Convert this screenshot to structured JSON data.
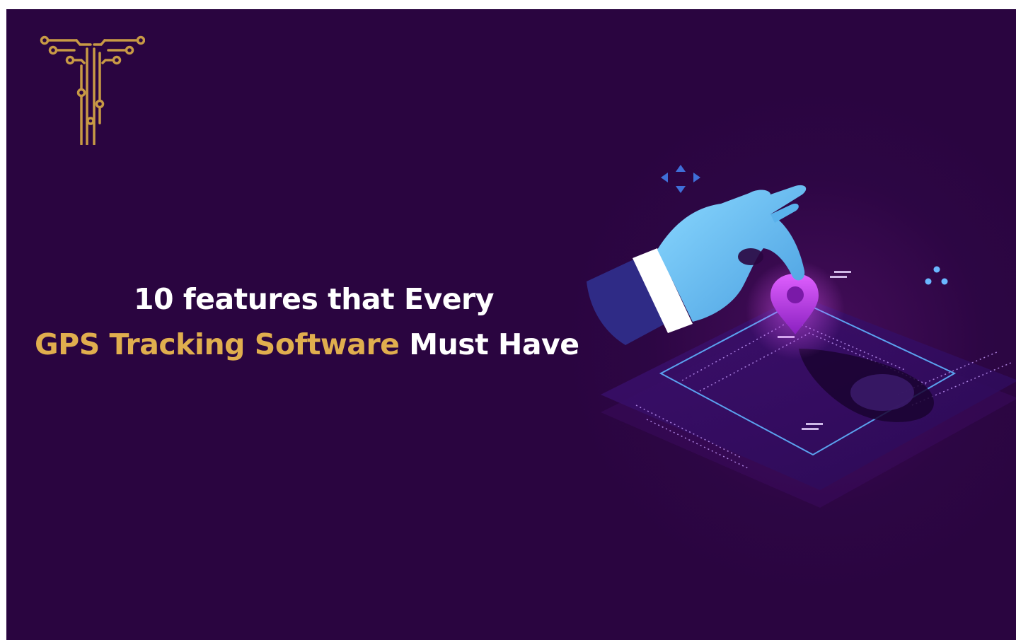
{
  "banner": {
    "title_line1": "10 features that Every",
    "title_line2_highlight": "GPS Tracking Software",
    "title_line2_rest": " Must Have"
  },
  "logo": {
    "icon": "circuit-t-logo-icon",
    "color": "#c89a45"
  },
  "illustration": {
    "icon": "hand-holding-location-pin-icon"
  },
  "colors": {
    "background": "#2a0540",
    "accent_gold": "#e0ae4e",
    "text": "#ffffff",
    "glove": "#6fc6f0",
    "pin": "#c040e0"
  }
}
